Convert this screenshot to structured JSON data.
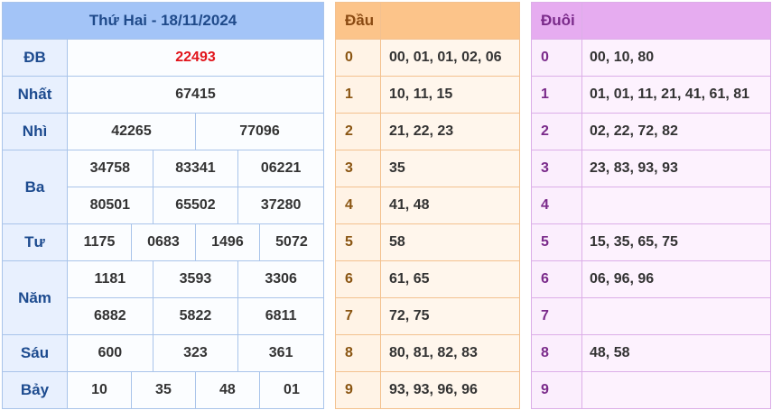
{
  "prize": {
    "title": "Thứ Hai - 18/11/2024",
    "special": {
      "label": "ĐB",
      "values": [
        "22493"
      ]
    },
    "first": {
      "label": "Nhất",
      "values": [
        "67415"
      ]
    },
    "second": {
      "label": "Nhì",
      "values": [
        "42265",
        "77096"
      ]
    },
    "third": {
      "label": "Ba",
      "values": [
        "34758",
        "83341",
        "06221",
        "80501",
        "65502",
        "37280"
      ]
    },
    "fourth": {
      "label": "Tư",
      "values": [
        "1175",
        "0683",
        "1496",
        "5072"
      ]
    },
    "fifth": {
      "label": "Năm",
      "values": [
        "1181",
        "3593",
        "3306",
        "6882",
        "5822",
        "6811"
      ]
    },
    "sixth": {
      "label": "Sáu",
      "values": [
        "600",
        "323",
        "361"
      ]
    },
    "seventh": {
      "label": "Bảy",
      "values": [
        "10",
        "35",
        "48",
        "01"
      ]
    }
  },
  "head": {
    "title": "Đầu",
    "rows": [
      {
        "key": "0",
        "nums": "00, 01, 01, 02, 06"
      },
      {
        "key": "1",
        "nums": "10, 11, 15"
      },
      {
        "key": "2",
        "nums": "21, 22, 23"
      },
      {
        "key": "3",
        "nums": "35"
      },
      {
        "key": "4",
        "nums": "41, 48"
      },
      {
        "key": "5",
        "nums": "58"
      },
      {
        "key": "6",
        "nums": "61, 65"
      },
      {
        "key": "7",
        "nums": "72, 75"
      },
      {
        "key": "8",
        "nums": "80, 81, 82, 83"
      },
      {
        "key": "9",
        "nums": "93, 93, 96, 96"
      }
    ]
  },
  "tail": {
    "title": "Đuôi",
    "rows": [
      {
        "key": "0",
        "nums": "00, 10, 80"
      },
      {
        "key": "1",
        "nums": "01, 01, 11, 21, 41, 61, 81"
      },
      {
        "key": "2",
        "nums": "02, 22, 72, 82"
      },
      {
        "key": "3",
        "nums": "23, 83, 93, 93"
      },
      {
        "key": "4",
        "nums": ""
      },
      {
        "key": "5",
        "nums": "15, 35, 65, 75"
      },
      {
        "key": "6",
        "nums": "06, 96, 96"
      },
      {
        "key": "7",
        "nums": ""
      },
      {
        "key": "8",
        "nums": "48, 58"
      },
      {
        "key": "9",
        "nums": ""
      }
    ]
  }
}
